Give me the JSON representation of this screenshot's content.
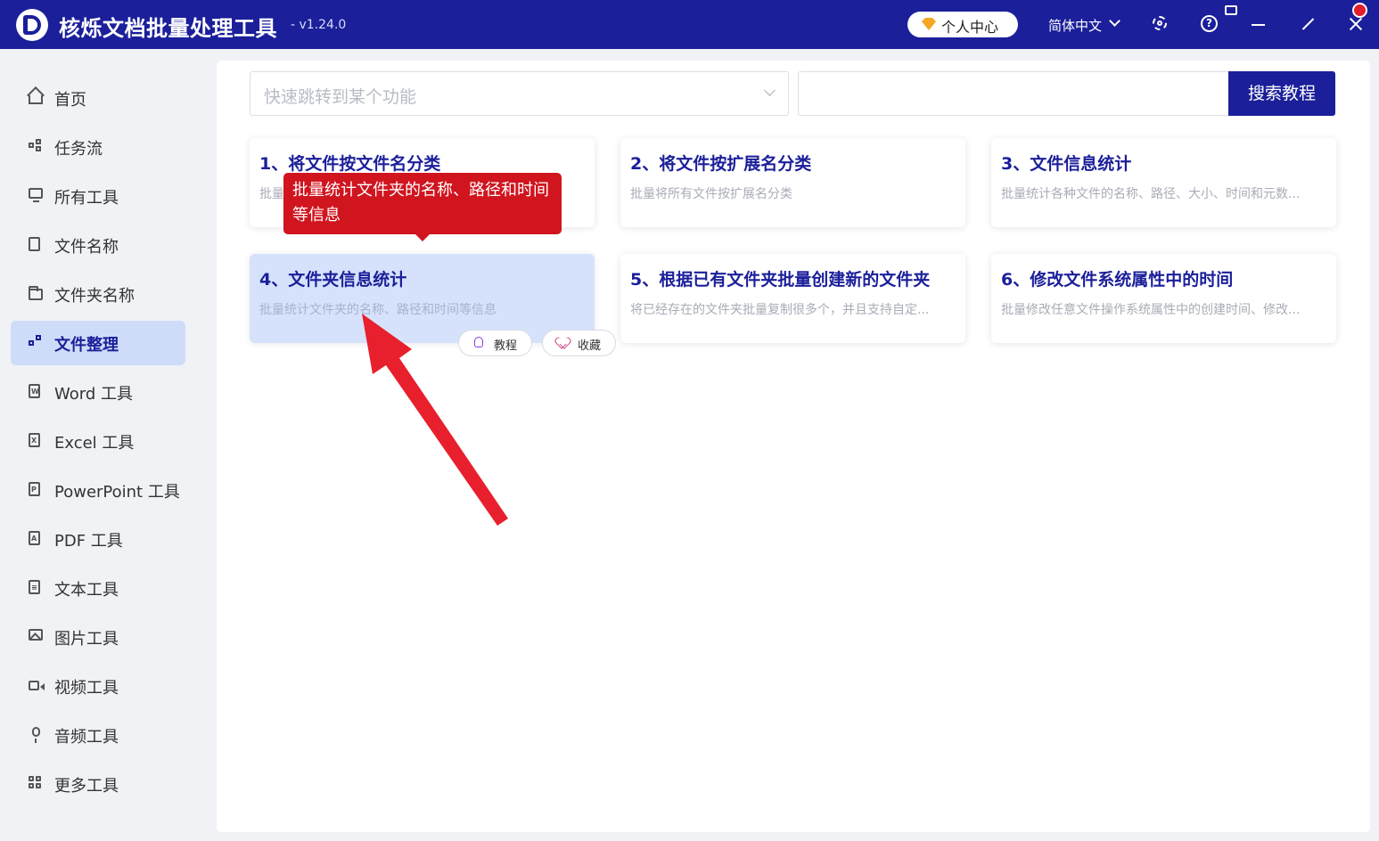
{
  "app": {
    "title": "核烁文档批量处理工具",
    "version": "- v1.24.0",
    "personal_center": "个人中心",
    "language": "简体中文",
    "icons": [
      "logo-icon",
      "crown-icon",
      "settings-icon",
      "help-icon",
      "feedback-icon",
      "minimize-icon",
      "maximize-icon",
      "close-icon"
    ]
  },
  "sidebar": {
    "items": [
      {
        "label": "首页",
        "icon": "home-icon"
      },
      {
        "label": "任务流",
        "icon": "flow-icon"
      },
      {
        "label": "所有工具",
        "icon": "monitor-icon"
      },
      {
        "label": "文件名称",
        "icon": "file-icon"
      },
      {
        "label": "文件夹名称",
        "icon": "folder-icon"
      },
      {
        "label": "文件整理",
        "icon": "organize-icon",
        "active": true
      },
      {
        "label": "Word 工具",
        "icon": "word-icon"
      },
      {
        "label": "Excel 工具",
        "icon": "excel-icon"
      },
      {
        "label": "PowerPoint 工具",
        "icon": "powerpoint-icon"
      },
      {
        "label": "PDF 工具",
        "icon": "pdf-icon"
      },
      {
        "label": "文本工具",
        "icon": "text-icon"
      },
      {
        "label": "图片工具",
        "icon": "image-icon"
      },
      {
        "label": "视频工具",
        "icon": "video-icon"
      },
      {
        "label": "音频工具",
        "icon": "audio-icon"
      },
      {
        "label": "更多工具",
        "icon": "grid-icon"
      }
    ]
  },
  "search": {
    "jump_placeholder": "快速跳转到某个功能",
    "tutorial_value": "",
    "button": "搜索教程"
  },
  "cards": [
    {
      "title": "1、将文件按文件名分类",
      "desc": "批量"
    },
    {
      "title": "2、将文件按扩展名分类",
      "desc": "批量将所有文件按扩展名分类"
    },
    {
      "title": "3、文件信息统计",
      "desc": "批量统计各种文件的名称、路径、大小、时间和元数..."
    },
    {
      "title": "4、文件夹信息统计",
      "desc": "批量统计文件夹的名称、路径和时间等信息"
    },
    {
      "title": "5、根据已有文件夹批量创建新的文件夹",
      "desc": "将已经存在的文件夹批量复制很多个，并且支持自定..."
    },
    {
      "title": "6、修改文件系统属性中的时间",
      "desc": "批量修改任意文件操作系统属性中的创建时间、修改..."
    }
  ],
  "card_actions": {
    "tutorial": "教程",
    "favorite": "收藏"
  },
  "tooltip": {
    "text": "批量统计文件夹的名称、路径和时间等信息"
  },
  "colors": {
    "brand": "#1b1f9a",
    "tooltip_bg": "#d0151f",
    "annotation_arrow": "#e8202e",
    "active_bg": "#cfdcf9"
  }
}
